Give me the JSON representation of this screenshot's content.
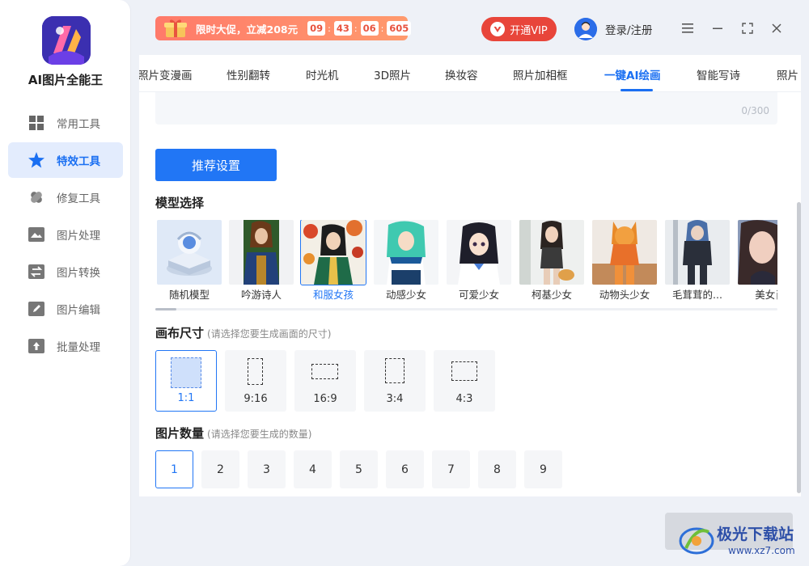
{
  "app": {
    "name": "AI图片全能王"
  },
  "sidebar": {
    "items": [
      {
        "label": "常用工具",
        "icon": "grid-icon",
        "active": false
      },
      {
        "label": "特效工具",
        "icon": "star-icon",
        "active": true
      },
      {
        "label": "修复工具",
        "icon": "bandage-icon",
        "active": false
      },
      {
        "label": "图片处理",
        "icon": "image-icon",
        "active": false
      },
      {
        "label": "图片转换",
        "icon": "swap-icon",
        "active": false
      },
      {
        "label": "图片编辑",
        "icon": "edit-icon",
        "active": false
      },
      {
        "label": "批量处理",
        "icon": "upload-icon",
        "active": false
      }
    ]
  },
  "header": {
    "promo_text": "限时大促，立减208元",
    "countdown": [
      "09",
      "43",
      "06",
      "605"
    ],
    "vip_label": "开通VIP",
    "login_label": "登录/注册"
  },
  "tabs": [
    {
      "label": "照片变漫画"
    },
    {
      "label": "性别翻转"
    },
    {
      "label": "时光机"
    },
    {
      "label": "3D照片"
    },
    {
      "label": "换妆容"
    },
    {
      "label": "照片加相框"
    },
    {
      "label": "一键AI绘画",
      "active": true
    },
    {
      "label": "智能写诗"
    },
    {
      "label": "照片"
    }
  ],
  "prompt": {
    "char_count": "0/300"
  },
  "recommend_button": "推荐设置",
  "model_section": {
    "title": "模型选择",
    "models": [
      {
        "label": "随机模型"
      },
      {
        "label": "吟游诗人"
      },
      {
        "label": "和服女孩",
        "active": true
      },
      {
        "label": "动感少女"
      },
      {
        "label": "可爱少女"
      },
      {
        "label": "柯基少女"
      },
      {
        "label": "动物头少女"
      },
      {
        "label": "毛茸茸的..."
      },
      {
        "label": "美女肖"
      }
    ]
  },
  "canvas_section": {
    "title": "画布尺寸",
    "hint": "(请选择您要生成画面的尺寸)",
    "sizes": [
      {
        "label": "1:1",
        "active": true
      },
      {
        "label": "9:16"
      },
      {
        "label": "16:9"
      },
      {
        "label": "3:4"
      },
      {
        "label": "4:3"
      }
    ]
  },
  "count_section": {
    "title": "图片数量",
    "hint": "(请选择您要生成的数量)",
    "counts": [
      "1",
      "2",
      "3",
      "4",
      "5",
      "6",
      "7",
      "8",
      "9"
    ],
    "selected": "1"
  },
  "watermark": {
    "text": "极光下载站",
    "url": "www.xz7.com"
  },
  "colors": {
    "accent": "#2176f5",
    "vip": "#e8453a",
    "promo": "#ff8a6b"
  }
}
